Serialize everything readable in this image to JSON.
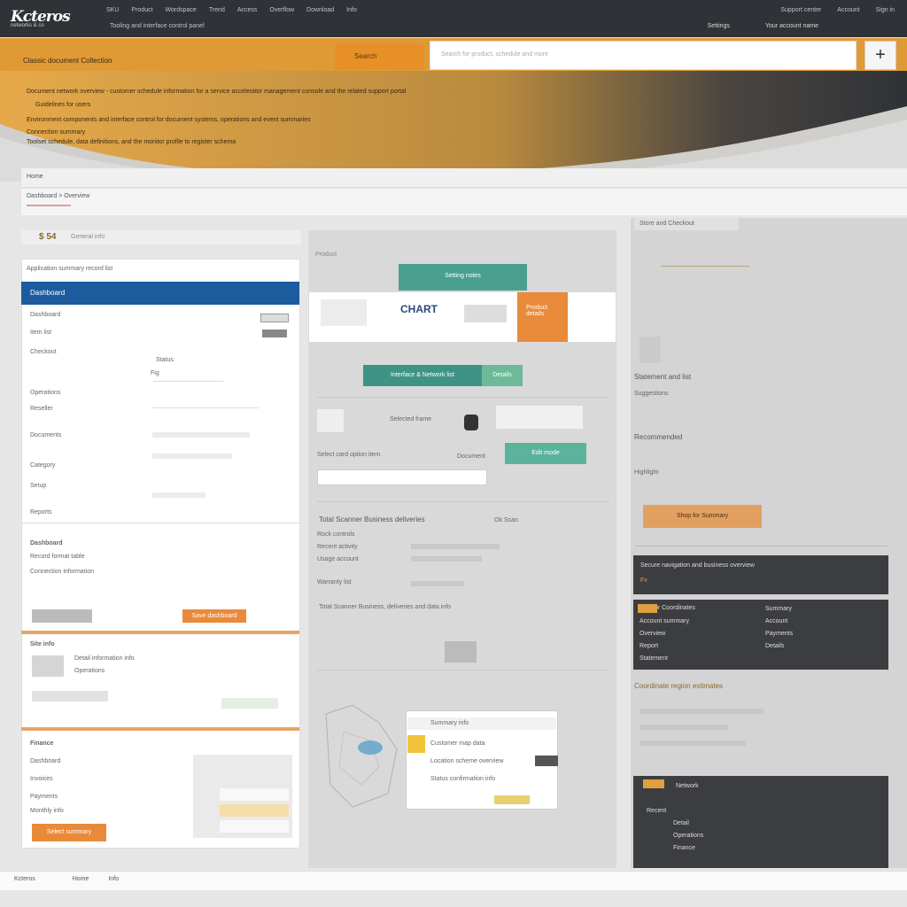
{
  "header": {
    "logo": "Kcteros",
    "logo_sub": "networks & co",
    "nav": [
      "SKU",
      "Product",
      "Wordspace",
      "Trend",
      "Access",
      "Overflow",
      "Download",
      "Info"
    ],
    "nav_sub": "Tooling and interface control panel",
    "top_links": [
      "Support center",
      "Account",
      "Sign in"
    ],
    "top_links2": [
      "Settings",
      "Your account name"
    ]
  },
  "orangebar": {
    "label": "Classic document Collection",
    "button": "Search",
    "search_placeholder": "Search for product, schedule and more",
    "add_icon": "plus-icon"
  },
  "hero": {
    "line1": "Document network overview - customer schedule information for a service accelerator management console and the related support portal",
    "line2": "Guidelines for users",
    "line3": "Environment components and interface control for document systems, operations and event summaries",
    "line4": "Connection summary",
    "line5": "Toolset schedule, data definitions, and the monitor profile to register schema"
  },
  "subbar": {
    "title": "Home",
    "crumb": "Dashboard > Overview"
  },
  "left": {
    "tag": "$ 54",
    "tag_text": "General info",
    "title": "Application summary record list",
    "head": "Dashboard",
    "rows": [
      "Dashboard",
      "Item list",
      "Checkout",
      "Operations",
      "Reseller",
      "Documents",
      "Category",
      "Setup",
      "Reports"
    ],
    "right_col": [
      "Status",
      "Fig"
    ],
    "section2": "Dashboard",
    "section2_rows": [
      "Record format table",
      "Connection information"
    ],
    "cta1": "Save dashboard",
    "section3": "Site info",
    "section3_rows": [
      "Detail information info",
      "Operations"
    ],
    "section4": "Finance",
    "section4_rows": [
      "Dashboard",
      "Invoices",
      "Payments",
      "Monthly info"
    ],
    "cta2": "Select summary"
  },
  "mid": {
    "title": "Product",
    "teal1": "Setting notes",
    "banner_text": "CHART",
    "banner_orange": "Product details",
    "teal2": "Interface & Network list",
    "teal2b": "Details",
    "row1": "Selected frame",
    "teal3": "Edit mode",
    "row2": "Select card option item",
    "row2b": "Document",
    "section": "Total Scanner Business deliveries",
    "section_b": "Ok Scan",
    "list": [
      "Rock controls",
      "Recent activity",
      "Usage account",
      "Warranty list"
    ],
    "note": "Total Scanner Business, deliveries and data info",
    "card_title": "Summary info",
    "card_rows": [
      "Customer map data",
      "Location scheme overview",
      "Status confirmation info"
    ]
  },
  "right": {
    "title": "Store and Checkout",
    "items": [
      "Statement and list",
      "Suggestions",
      "Recommended",
      "Highlight"
    ],
    "cta": "Shop for Summary",
    "dark1": "Secure navigation and business overview",
    "dark1_b": "Fx",
    "dark2_title": "Vendor Coordinates",
    "dark2_rows": [
      "Account summary",
      "Overview",
      "Report",
      "Statement"
    ],
    "dark2_right": [
      "Summary",
      "Account",
      "Payments",
      "Details"
    ],
    "section": "Coordinate region estimates",
    "dark3_title": "Network",
    "dark3_rows": [
      "Recent",
      "Detail",
      "Operations",
      "Finance"
    ]
  },
  "footer": {
    "text": "Kcteros",
    "links": [
      "Home",
      "Info"
    ]
  },
  "colors": {
    "orange": "#e09a35",
    "dark": "#2f3236",
    "blue": "#1c5b9d",
    "teal": "#4aa08e"
  }
}
